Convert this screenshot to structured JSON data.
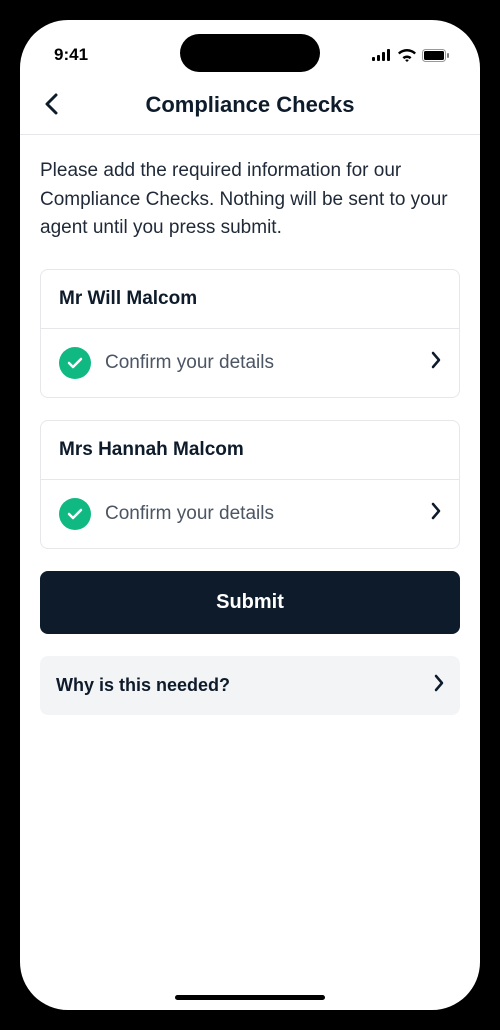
{
  "status": {
    "time": "9:41"
  },
  "nav": {
    "title": "Compliance Checks"
  },
  "intro": "Please add the required information for our Compliance Checks. Nothing will be sent to your agent until you press submit.",
  "people": [
    {
      "name": "Mr Will Malcom",
      "action_label": "Confirm your details"
    },
    {
      "name": "Mrs Hannah Malcom",
      "action_label": "Confirm your details"
    }
  ],
  "submit_label": "Submit",
  "why_label": "Why is this needed?"
}
